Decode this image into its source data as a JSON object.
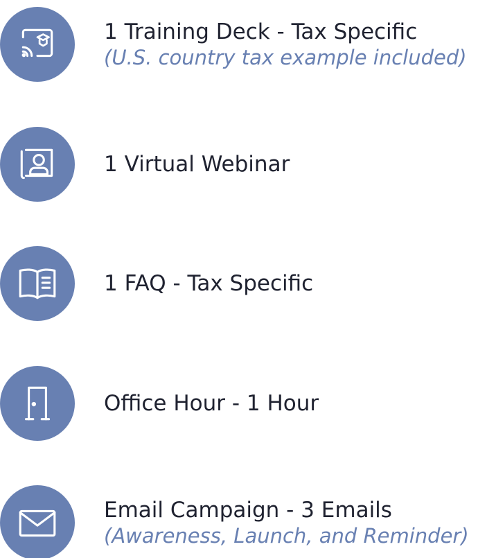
{
  "colors": {
    "icon_circle": "#6880b2",
    "icon_stroke": "#ffffff",
    "main_text": "#1f2230",
    "sub_text": "#6880b2"
  },
  "items": [
    {
      "icon": "presentation-screen-icon",
      "title": "1 Training Deck - Tax Specific",
      "subtitle": "(U.S. country tax example included)"
    },
    {
      "icon": "webinar-user-icon",
      "title": "1 Virtual Webinar",
      "subtitle": ""
    },
    {
      "icon": "open-book-icon",
      "title": "1 FAQ - Tax Specific",
      "subtitle": ""
    },
    {
      "icon": "door-icon",
      "title": "Office Hour - 1 Hour",
      "subtitle": ""
    },
    {
      "icon": "envelope-icon",
      "title": "Email Campaign - 3 Emails",
      "subtitle": "(Awareness, Launch, and Reminder)"
    }
  ]
}
